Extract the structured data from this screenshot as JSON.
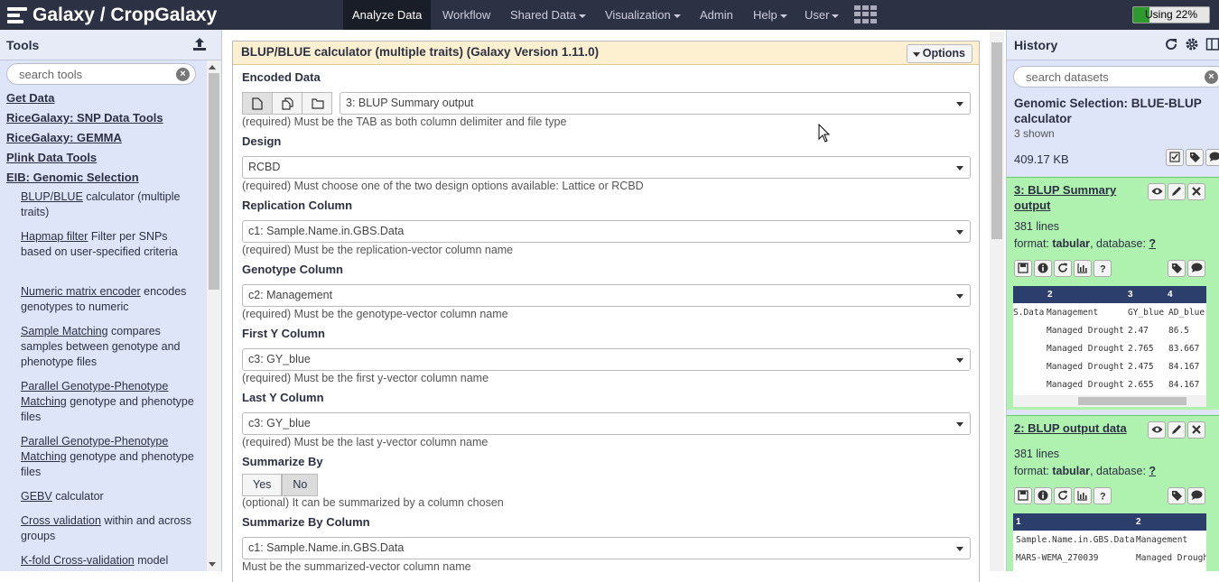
{
  "brand": {
    "title": "Galaxy / CropGalaxy"
  },
  "nav": {
    "analyze": "Analyze Data",
    "workflow": "Workflow",
    "shared": "Shared Data",
    "visualization": "Visualization",
    "admin": "Admin",
    "help": "Help",
    "user": "User"
  },
  "quota": {
    "label": "Using 22%",
    "percent": 22,
    "color": "#2d9a2d"
  },
  "tools": {
    "title": "Tools",
    "search_placeholder": "search tools",
    "sections": [
      "Get Data",
      "RiceGalaxy: SNP Data Tools",
      "RiceGalaxy: GEMMA",
      "Plink Data Tools",
      "EIB: Genomic Selection"
    ],
    "items": [
      {
        "link": "BLUP/BLUE",
        "desc": " calculator (multiple traits)"
      },
      {
        "link": "Hapmap filter",
        "desc": " Filter per SNPs based on user-specified criteria"
      },
      {
        "link": "Numeric matrix encoder",
        "desc": " encodes genotypes to numeric"
      },
      {
        "link": "Sample Matching",
        "desc": " compares samples between genotype and phenotype files"
      },
      {
        "link": "Parallel Genotype-Phenotype Matching",
        "desc": " genotype and phenotype files"
      },
      {
        "link": "Parallel Genotype-Phenotype Matching",
        "desc": " genotype and phenotype files"
      },
      {
        "link": "GEBV",
        "desc": " calculator"
      },
      {
        "link": "Cross validation",
        "desc": " within and across groups"
      },
      {
        "link": "K-fold Cross-validation",
        "desc": " model"
      }
    ]
  },
  "form": {
    "title": "BLUP/BLUE calculator (multiple traits) (Galaxy Version 1.11.0)",
    "options": "Options",
    "fields": [
      {
        "label": "Encoded Data",
        "value": "3: BLUP Summary output",
        "help": "(required) Must be the TAB as both column delimiter and file type"
      },
      {
        "label": "Design",
        "value": "RCBD",
        "help": "(required) Must choose one of the two design options available: Lattice or RCBD"
      },
      {
        "label": "Replication Column",
        "value": "c1: Sample.Name.in.GBS.Data",
        "help": "(required) Must be the replication-vector column name"
      },
      {
        "label": "Genotype Column",
        "value": "c2: Management",
        "help": "(required) Must be the genotype-vector column name"
      },
      {
        "label": "First Y Column",
        "value": "c3: GY_blue",
        "help": "(required) Must be the first y-vector column name"
      },
      {
        "label": "Last Y Column",
        "value": "c3: GY_blue",
        "help": "(required) Must be the last y-vector column name"
      },
      {
        "label": "Summarize By",
        "value": "",
        "help": "(optional) It can be summarized by a column chosen"
      },
      {
        "label": "Summarize By Column",
        "value": "c1: Sample.Name.in.GBS.Data",
        "help": "Must be the summarized-vector column name"
      }
    ],
    "yes": "Yes",
    "no": "No"
  },
  "history": {
    "title": "History",
    "search_placeholder": "search datasets",
    "name": "Genomic Selection: BLUE-BLUP calculator",
    "shown": "3 shown",
    "size": "409.17 KB",
    "datasets": [
      {
        "name": "3: BLUP Summary output",
        "lines": "381 lines",
        "format_label": "format: ",
        "format": "tabular",
        "db_label": ", database: ",
        "db": "?",
        "peek_headers": [
          "2",
          "3",
          "4"
        ],
        "peek_rows": [
          [
            "S.Data",
            "Management",
            "GY_blue",
            "AD_blue"
          ],
          [
            "",
            "Managed Drought",
            "2.47",
            "86.5"
          ],
          [
            "",
            "Managed Drought",
            "2.765",
            "83.667"
          ],
          [
            "",
            "Managed Drought",
            "2.475",
            "84.167"
          ],
          [
            "",
            "Managed Drought",
            "2.655",
            "84.167"
          ]
        ]
      },
      {
        "name": "2: BLUP output data",
        "lines": "381 lines",
        "format_label": "format: ",
        "format": "tabular",
        "db_label": ", database: ",
        "db": "?",
        "peek_headers": [
          "1",
          "2"
        ],
        "peek_rows": [
          [
            "Sample.Name.in.GBS.Data",
            "Management"
          ],
          [
            "MARS-WEMA_270039",
            "Managed Drought"
          ]
        ]
      }
    ]
  }
}
